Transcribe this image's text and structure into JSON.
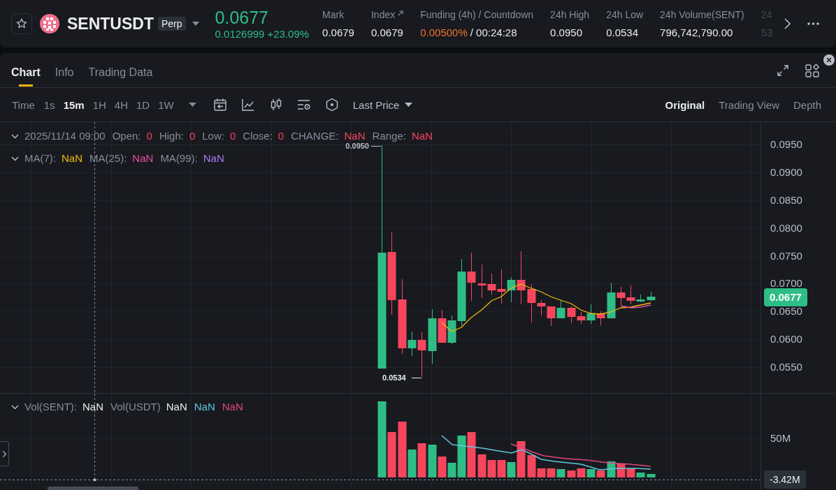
{
  "header": {
    "symbol": "SENTUSDT",
    "badge": "Perp",
    "price": "0.0677",
    "change": "0.0126999",
    "change_percent": "+23.09%",
    "stats": [
      {
        "kind": "plain",
        "label": "Mark",
        "value": "0.0679"
      },
      {
        "kind": "link",
        "label": "Index",
        "value": "0.0679"
      },
      {
        "kind": "funding",
        "label": "Funding (4h) / Countdown",
        "rate": "0.00500%",
        "countdown": "/ 00:24:28"
      },
      {
        "kind": "plain",
        "label": "24h High",
        "value": "0.0950"
      },
      {
        "kind": "plain",
        "label": "24h Low",
        "value": "0.0534"
      },
      {
        "kind": "plain",
        "label": "24h Volume(SENT)",
        "value": "796,742,790.00"
      },
      {
        "kind": "cut",
        "label": "24",
        "value": "53"
      }
    ]
  },
  "tabs": [
    {
      "label": "Chart",
      "selected": true
    },
    {
      "label": "Info",
      "selected": false
    },
    {
      "label": "Trading Data",
      "selected": false
    }
  ],
  "toolbar": {
    "time_label": "Time",
    "intervals": [
      {
        "label": "1s",
        "selected": false
      },
      {
        "label": "15m",
        "selected": true
      },
      {
        "label": "1H",
        "selected": false
      },
      {
        "label": "4H",
        "selected": false
      },
      {
        "label": "1D",
        "selected": false
      },
      {
        "label": "1W",
        "selected": false
      }
    ],
    "price_source": "Last Price",
    "views": [
      {
        "label": "Original",
        "selected": true
      },
      {
        "label": "Trading View",
        "selected": false
      },
      {
        "label": "Depth",
        "selected": false
      }
    ]
  },
  "chart": {
    "legend": {
      "date": "2025/11/14 09:00",
      "fields": [
        {
          "label": "Open:",
          "value": "0"
        },
        {
          "label": "High:",
          "value": "0"
        },
        {
          "label": "Low:",
          "value": "0"
        },
        {
          "label": "Close:",
          "value": "0"
        },
        {
          "label": "CHANGE:",
          "value": "NaN"
        },
        {
          "label": "Range:",
          "value": "NaN"
        }
      ]
    },
    "moving_averages": [
      {
        "label": "MA(7):",
        "value": "NaN",
        "color": "#f0b90b"
      },
      {
        "label": "MA(25):",
        "value": "NaN",
        "color": "#e84fa3"
      },
      {
        "label": "MA(99):",
        "value": "NaN",
        "color": "#a57cf0"
      }
    ],
    "high_label": "0.0950",
    "low_label": "0.0534",
    "price_axis": {
      "ticks": [
        "0.0950",
        "0.0900",
        "0.0850",
        "0.0800",
        "0.0750",
        "0.0700",
        "0.0650",
        "0.0600",
        "0.0550"
      ],
      "current_price": "0.0677"
    }
  },
  "volume": {
    "legend": [
      {
        "label": "Vol(SENT):",
        "value": "NaN",
        "color": "#eaecef"
      },
      {
        "label": "Vol(USDT)",
        "value": "NaN",
        "color": "#eaecef"
      },
      {
        "value": "NaN",
        "color": "#5fc6dc"
      },
      {
        "value": "NaN",
        "color": "#e0457b"
      }
    ],
    "axis_label": "50M",
    "crosshair_value": "-3.42M"
  }
}
